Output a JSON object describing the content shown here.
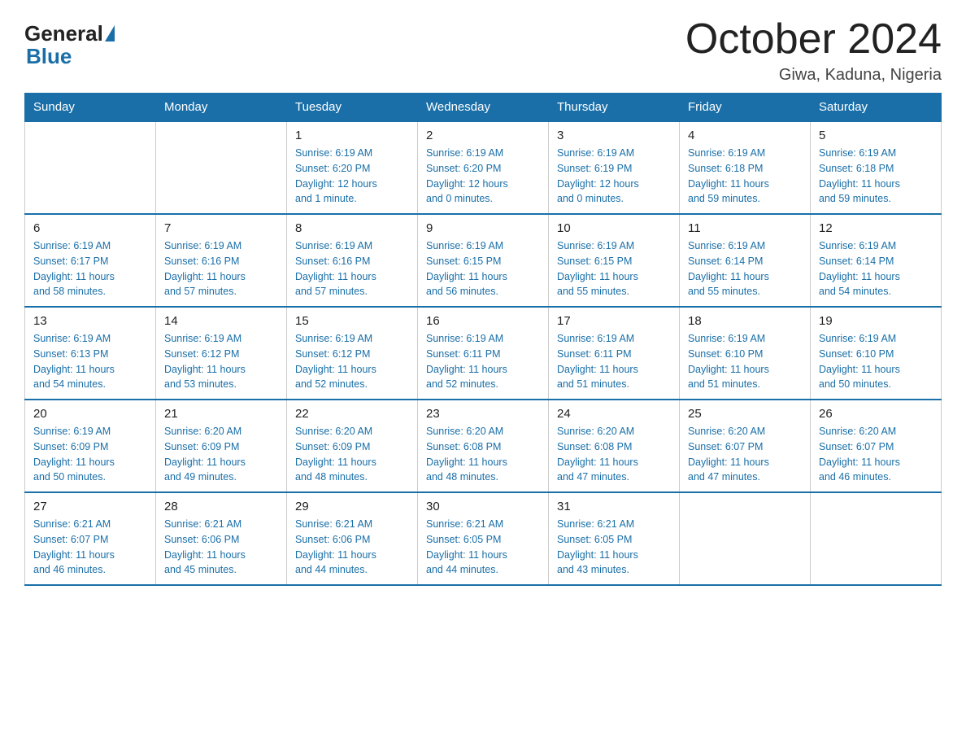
{
  "header": {
    "logo_general": "General",
    "logo_blue": "Blue",
    "month_title": "October 2024",
    "location": "Giwa, Kaduna, Nigeria"
  },
  "days_of_week": [
    "Sunday",
    "Monday",
    "Tuesday",
    "Wednesday",
    "Thursday",
    "Friday",
    "Saturday"
  ],
  "weeks": [
    [
      {
        "day": "",
        "info": ""
      },
      {
        "day": "",
        "info": ""
      },
      {
        "day": "1",
        "info": "Sunrise: 6:19 AM\nSunset: 6:20 PM\nDaylight: 12 hours\nand 1 minute."
      },
      {
        "day": "2",
        "info": "Sunrise: 6:19 AM\nSunset: 6:20 PM\nDaylight: 12 hours\nand 0 minutes."
      },
      {
        "day": "3",
        "info": "Sunrise: 6:19 AM\nSunset: 6:19 PM\nDaylight: 12 hours\nand 0 minutes."
      },
      {
        "day": "4",
        "info": "Sunrise: 6:19 AM\nSunset: 6:18 PM\nDaylight: 11 hours\nand 59 minutes."
      },
      {
        "day": "5",
        "info": "Sunrise: 6:19 AM\nSunset: 6:18 PM\nDaylight: 11 hours\nand 59 minutes."
      }
    ],
    [
      {
        "day": "6",
        "info": "Sunrise: 6:19 AM\nSunset: 6:17 PM\nDaylight: 11 hours\nand 58 minutes."
      },
      {
        "day": "7",
        "info": "Sunrise: 6:19 AM\nSunset: 6:16 PM\nDaylight: 11 hours\nand 57 minutes."
      },
      {
        "day": "8",
        "info": "Sunrise: 6:19 AM\nSunset: 6:16 PM\nDaylight: 11 hours\nand 57 minutes."
      },
      {
        "day": "9",
        "info": "Sunrise: 6:19 AM\nSunset: 6:15 PM\nDaylight: 11 hours\nand 56 minutes."
      },
      {
        "day": "10",
        "info": "Sunrise: 6:19 AM\nSunset: 6:15 PM\nDaylight: 11 hours\nand 55 minutes."
      },
      {
        "day": "11",
        "info": "Sunrise: 6:19 AM\nSunset: 6:14 PM\nDaylight: 11 hours\nand 55 minutes."
      },
      {
        "day": "12",
        "info": "Sunrise: 6:19 AM\nSunset: 6:14 PM\nDaylight: 11 hours\nand 54 minutes."
      }
    ],
    [
      {
        "day": "13",
        "info": "Sunrise: 6:19 AM\nSunset: 6:13 PM\nDaylight: 11 hours\nand 54 minutes."
      },
      {
        "day": "14",
        "info": "Sunrise: 6:19 AM\nSunset: 6:12 PM\nDaylight: 11 hours\nand 53 minutes."
      },
      {
        "day": "15",
        "info": "Sunrise: 6:19 AM\nSunset: 6:12 PM\nDaylight: 11 hours\nand 52 minutes."
      },
      {
        "day": "16",
        "info": "Sunrise: 6:19 AM\nSunset: 6:11 PM\nDaylight: 11 hours\nand 52 minutes."
      },
      {
        "day": "17",
        "info": "Sunrise: 6:19 AM\nSunset: 6:11 PM\nDaylight: 11 hours\nand 51 minutes."
      },
      {
        "day": "18",
        "info": "Sunrise: 6:19 AM\nSunset: 6:10 PM\nDaylight: 11 hours\nand 51 minutes."
      },
      {
        "day": "19",
        "info": "Sunrise: 6:19 AM\nSunset: 6:10 PM\nDaylight: 11 hours\nand 50 minutes."
      }
    ],
    [
      {
        "day": "20",
        "info": "Sunrise: 6:19 AM\nSunset: 6:09 PM\nDaylight: 11 hours\nand 50 minutes."
      },
      {
        "day": "21",
        "info": "Sunrise: 6:20 AM\nSunset: 6:09 PM\nDaylight: 11 hours\nand 49 minutes."
      },
      {
        "day": "22",
        "info": "Sunrise: 6:20 AM\nSunset: 6:09 PM\nDaylight: 11 hours\nand 48 minutes."
      },
      {
        "day": "23",
        "info": "Sunrise: 6:20 AM\nSunset: 6:08 PM\nDaylight: 11 hours\nand 48 minutes."
      },
      {
        "day": "24",
        "info": "Sunrise: 6:20 AM\nSunset: 6:08 PM\nDaylight: 11 hours\nand 47 minutes."
      },
      {
        "day": "25",
        "info": "Sunrise: 6:20 AM\nSunset: 6:07 PM\nDaylight: 11 hours\nand 47 minutes."
      },
      {
        "day": "26",
        "info": "Sunrise: 6:20 AM\nSunset: 6:07 PM\nDaylight: 11 hours\nand 46 minutes."
      }
    ],
    [
      {
        "day": "27",
        "info": "Sunrise: 6:21 AM\nSunset: 6:07 PM\nDaylight: 11 hours\nand 46 minutes."
      },
      {
        "day": "28",
        "info": "Sunrise: 6:21 AM\nSunset: 6:06 PM\nDaylight: 11 hours\nand 45 minutes."
      },
      {
        "day": "29",
        "info": "Sunrise: 6:21 AM\nSunset: 6:06 PM\nDaylight: 11 hours\nand 44 minutes."
      },
      {
        "day": "30",
        "info": "Sunrise: 6:21 AM\nSunset: 6:05 PM\nDaylight: 11 hours\nand 44 minutes."
      },
      {
        "day": "31",
        "info": "Sunrise: 6:21 AM\nSunset: 6:05 PM\nDaylight: 11 hours\nand 43 minutes."
      },
      {
        "day": "",
        "info": ""
      },
      {
        "day": "",
        "info": ""
      }
    ]
  ]
}
